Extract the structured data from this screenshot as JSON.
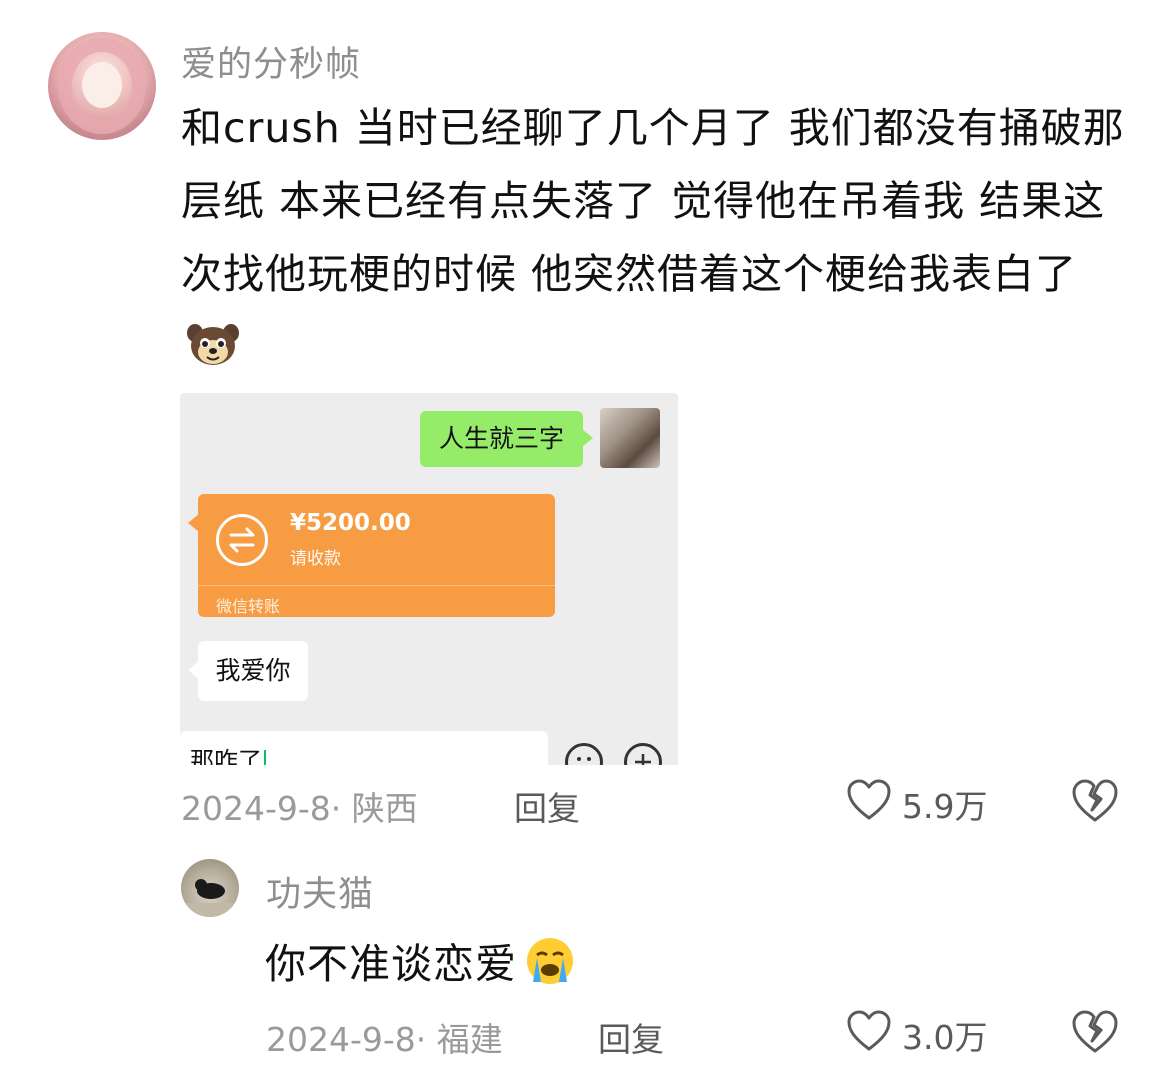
{
  "comment1": {
    "username": "爱的分秒帧",
    "text": "和crush 当时已经聊了几个月了 我们都没有捅破那层纸 本来已经有点失落了 觉得他在吊着我 结果这次找他玩梗的时候 他突然借着这个梗给我表白了",
    "emoji": "dog-emoji",
    "date_location": "2024-9-8· 陕西",
    "reply_label": "回复",
    "likes": "5.9万",
    "screenshot": {
      "sent_message": "人生就三字",
      "transfer_amount": "¥5200.00",
      "transfer_status": "请收款",
      "transfer_source": "微信转账",
      "received_message": "我爱你",
      "input_text": "那咋了"
    }
  },
  "comment2": {
    "username": "功夫猫",
    "text": "你不准谈恋爱",
    "emoji": "crying-face-emoji",
    "date_location": "2024-9-8· 福建",
    "reply_label": "回复",
    "likes": "3.0万"
  },
  "colors": {
    "wechat_green": "#95ec69",
    "transfer_orange": "#f79c42",
    "meta_gray": "#9a9a9a"
  }
}
